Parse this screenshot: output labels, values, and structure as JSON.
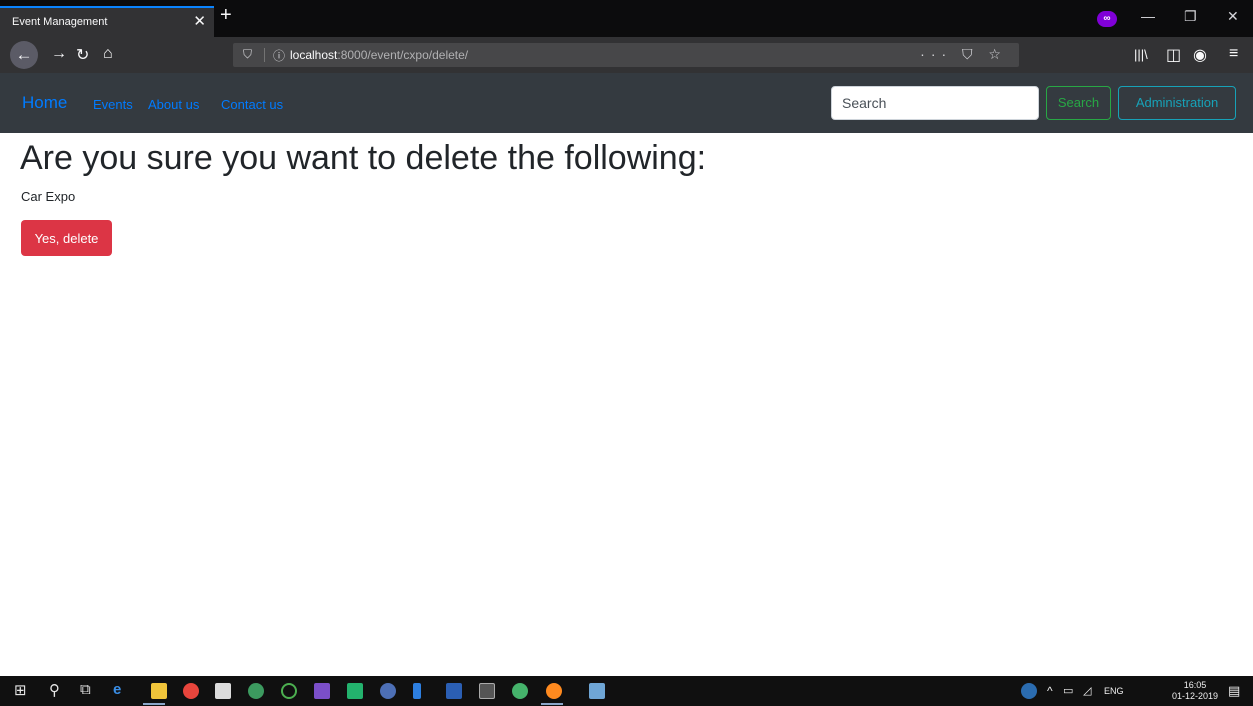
{
  "browser": {
    "tab_title": "Event Management",
    "tab_close": "✕",
    "new_tab": "+",
    "url_host": "localhost",
    "url_path": ":8000/event/cxpo/delete/",
    "url_actions": "··· ⛉ ☆"
  },
  "navbar": {
    "brand": "Home",
    "links": [
      "Events",
      "About us",
      "Contact us"
    ],
    "search_placeholder": "Search",
    "search_button": "Search",
    "admin_button": "Administration"
  },
  "page": {
    "heading": "Are you sure you want to delete the following:",
    "item_name": "Car Expo",
    "delete_button": "Yes, delete"
  },
  "taskbar": {
    "language": "ENG",
    "time": "16:05",
    "date": "01-12-2019"
  },
  "colors": {
    "primary": "#007bff",
    "success": "#28a745",
    "info": "#17a2b8",
    "danger": "#dc3545",
    "navbar_bg": "#343a40"
  }
}
